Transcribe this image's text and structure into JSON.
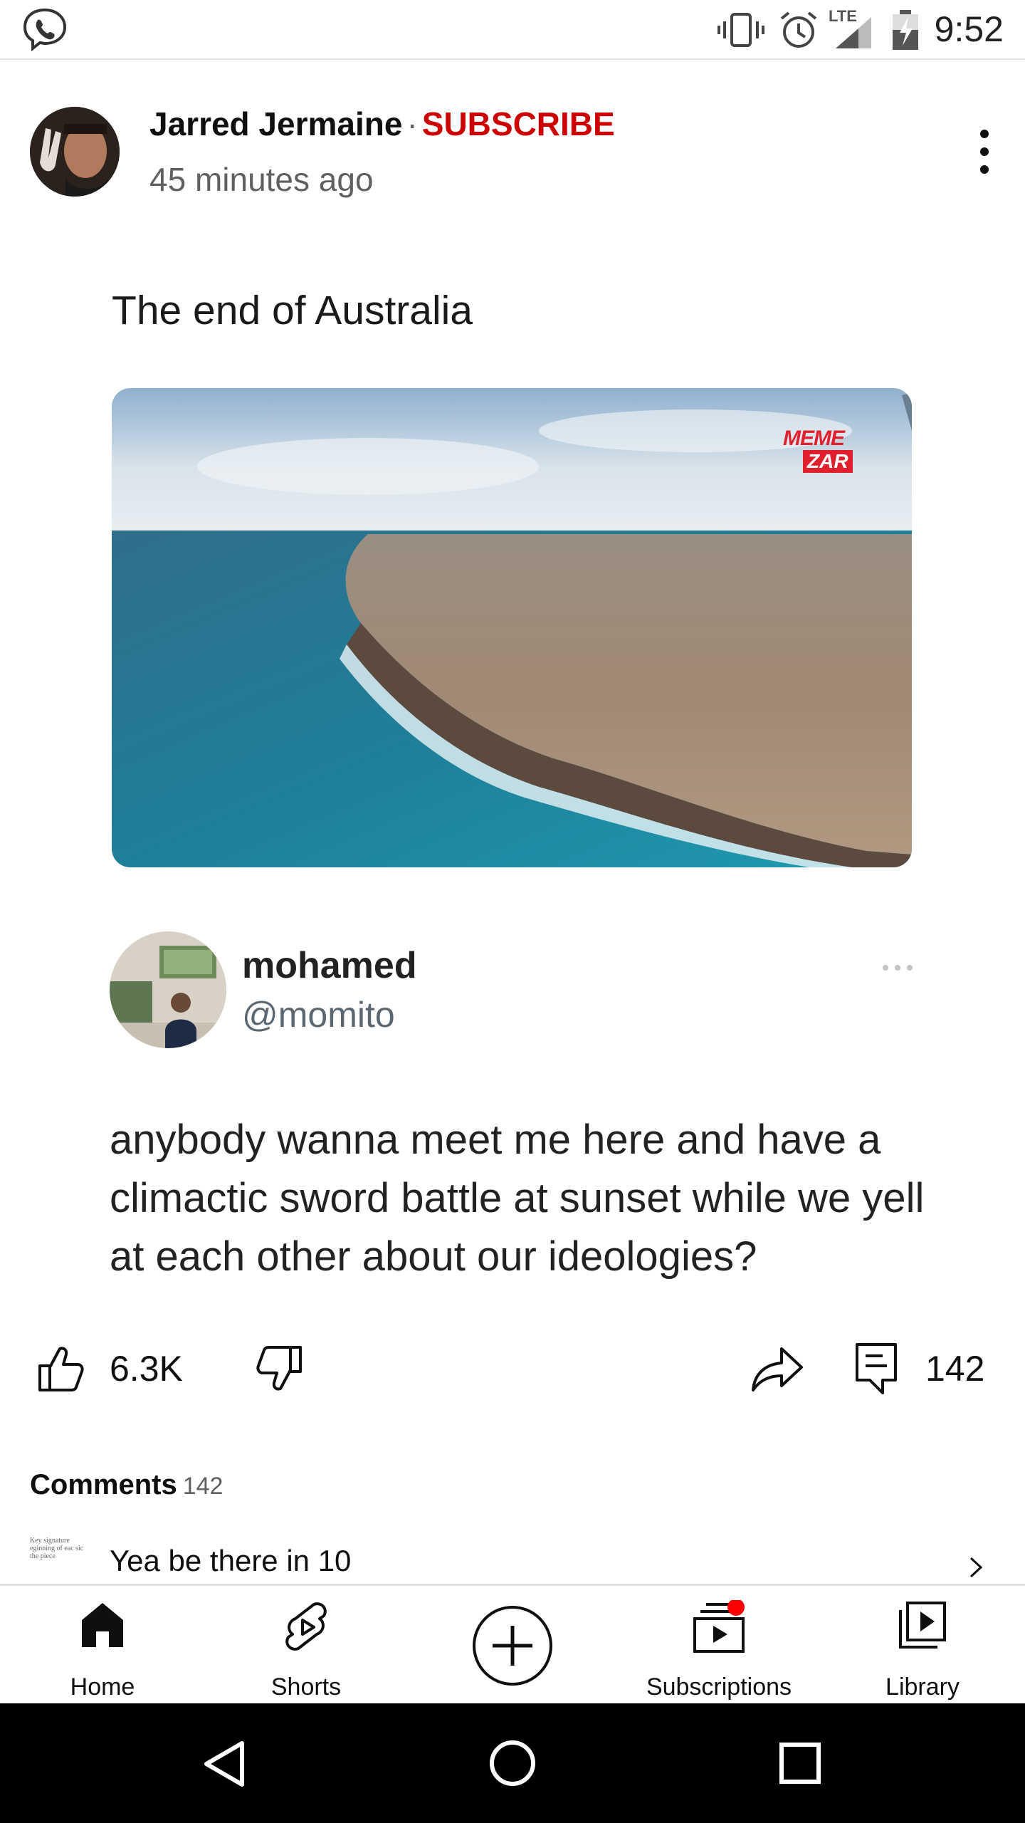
{
  "status_bar": {
    "time": "9:52",
    "network": "LTE"
  },
  "post": {
    "author": "Jarred Jermaine",
    "separator": "·",
    "subscribe_label": "SUBSCRIBE",
    "time_ago": "45 minutes ago"
  },
  "meme": {
    "title": "The end of Australia",
    "watermark_line1": "MEME",
    "watermark_line2": "ZAR",
    "tweet_name": "mohamed",
    "tweet_handle": "@momito",
    "tweet_text": "anybody wanna meet me here and have a climactic sword battle at sunset while we yell at each other about our ideologies?"
  },
  "actions": {
    "like_count": "6.3K",
    "comment_count": "142"
  },
  "comments": {
    "heading": "Comments",
    "count": "142",
    "preview_text": "Yea be there in 10",
    "thumb_text": "Key signature eginning of eac sic the piece"
  },
  "nav": {
    "home": "Home",
    "shorts": "Shorts",
    "subscriptions": "Subscriptions",
    "library": "Library"
  },
  "colors": {
    "subscribe_red": "#cc0000",
    "notification_dot": "#ff0000",
    "secondary_text": "#606060",
    "android_nav_bg": "#000000"
  }
}
